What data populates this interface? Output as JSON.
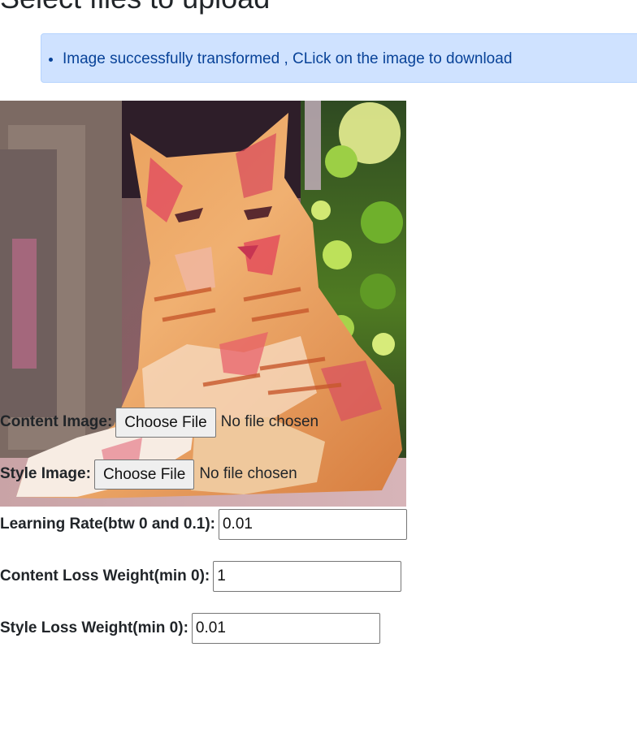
{
  "page": {
    "title": "Select files to upload"
  },
  "alert": {
    "message": "Image successfully transformed , CLick on the image to download",
    "color": "#084298",
    "background": "#cfe2ff"
  },
  "result_image": {
    "alt": "Stylized cat image"
  },
  "form": {
    "content_image": {
      "label": "Content Image:",
      "button_label": "Choose File",
      "status": "No file chosen"
    },
    "style_image": {
      "label": "Style Image:",
      "button_label": "Choose File",
      "status": "No file chosen"
    },
    "learning_rate": {
      "label": "Learning Rate(btw 0 and 0.1):",
      "value": "0.01"
    },
    "content_loss_weight": {
      "label": "Content Loss Weight(min 0):",
      "value": "1"
    },
    "style_loss_weight": {
      "label": "Style Loss Weight(min 0):",
      "value": "0.01"
    }
  }
}
